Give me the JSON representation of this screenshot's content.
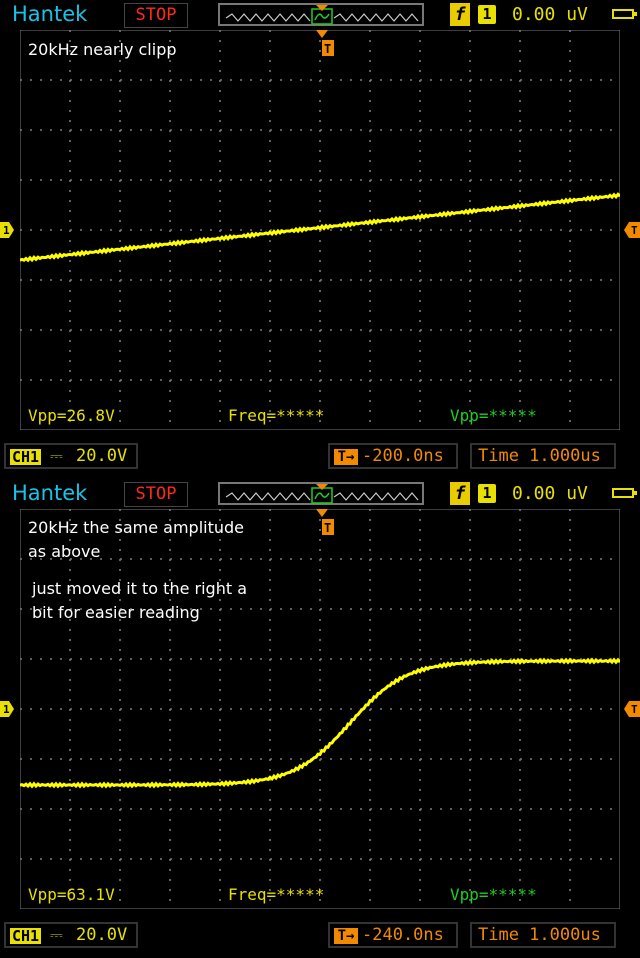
{
  "colors": {
    "brand": "#19c3e6",
    "stop": "#ff2a1e",
    "trace": "#ffff00",
    "meas_ch1": "#e8e000",
    "meas_ch2": "#22cc22",
    "trigger": "#f28a00",
    "grid": "#7a7a7a"
  },
  "icons": {
    "trigger_marker": "T-triangle",
    "channel_marker": "1-arrow",
    "battery": "battery-icon",
    "trigger_edge": "rising-edge-f"
  },
  "panels": [
    {
      "header": {
        "brand": "Hantek",
        "run_state": "STOP",
        "trigger_source": "1",
        "trigger_level": "0.00",
        "trigger_unit": "uV",
        "edge_symbol": "f"
      },
      "annotations": [
        "20kHz nearly clipp"
      ],
      "measurements": {
        "vpp_ch1": "Vpp=26.8V",
        "freq": "Freq=*****",
        "vpp_ch2": "Vpp=*****"
      },
      "footer": {
        "channel": "CH1",
        "coupling": "DC",
        "volts_div": "20.0V",
        "trigger_pos": "-200.0ns",
        "timebase": "Time 1.000us"
      }
    },
    {
      "header": {
        "brand": "Hantek",
        "run_state": "STOP",
        "trigger_source": "1",
        "trigger_level": "0.00",
        "trigger_unit": "uV",
        "edge_symbol": "f"
      },
      "annotations": [
        "20kHz the same amplitude",
        "as above",
        "just moved it to the right a",
        "bit for easier reading"
      ],
      "measurements": {
        "vpp_ch1": "Vpp=63.1V",
        "freq": "Freq=*****",
        "vpp_ch2": "Vpp=*****"
      },
      "footer": {
        "channel": "CH1",
        "coupling": "DC",
        "volts_div": "20.0V",
        "trigger_pos": "-240.0ns",
        "timebase": "Time 1.000us"
      }
    }
  ]
}
